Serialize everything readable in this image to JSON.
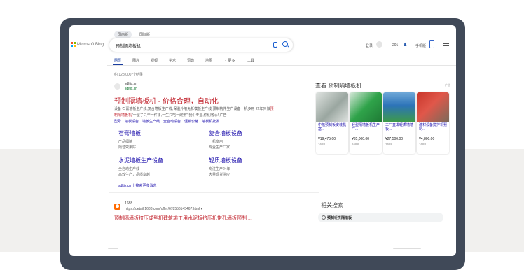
{
  "header": {
    "scopes": [
      {
        "label": "国内版",
        "active": true
      },
      {
        "label": "国际版",
        "active": false
      }
    ],
    "logo_text": "Microsoft Bing",
    "query": "预制隔墙板机",
    "sign_in": "登录",
    "points": "201",
    "mobile": "手机版"
  },
  "tabs": [
    {
      "label": "网页",
      "active": true
    },
    {
      "label": "图片",
      "active": false
    },
    {
      "label": "视频",
      "active": false
    },
    {
      "label": "学术",
      "active": false
    },
    {
      "label": "词典",
      "active": false
    },
    {
      "label": "地图",
      "active": false
    },
    {
      "label": "⋮ 更多",
      "active": false
    },
    {
      "label": "工具",
      "active": false
    }
  ],
  "result_count": "约 128,000 个结果",
  "result1": {
    "site": "sdltjx.cn",
    "url": "sdltjx.cn",
    "title": "预制隔墙板机 - 价格合理，自动化",
    "snippet1_a": "设备 石膏墙板生产线,复合墙板生产线,保温外墙免拆模板生产线,预制构件生产设备一机多用 22年只做",
    "snippet1_b": "预",
    "snippet2_a": "制隔墙板机",
    "snippet2_b": "\"一屋子只干一件事,一生只吃一碗粥\",我们专业,你们省心! 广告",
    "links": [
      "型号",
      "墙板设备",
      "墙板生产线",
      "全自动设备",
      "促销价格",
      "墙板机批发"
    ],
    "sitelinks": [
      {
        "title": "石膏墙板",
        "d1": "产品细腻",
        "d2": "隔音效果好"
      },
      {
        "title": "复合墙板设备",
        "d1": "一机多用",
        "d2": "专业生产厂家"
      },
      {
        "title": "水泥墙板生产设备",
        "d1": "全自动生产线",
        "d2": "高效生产，品质卓越"
      },
      {
        "title": "轻质墙板设备",
        "d1": "专注生产24年",
        "d2": "大量现货供应"
      }
    ],
    "more": "sdltjx.cn 上搜索更多消息"
  },
  "result2": {
    "site": "1688",
    "url": "https://detail.1688.com/offer/678556145467.html ▾",
    "title": "预制隔墙板挤压成型机建筑施工用水泥板挤压机带孔墙板预制 ..."
  },
  "right": {
    "title": "查看 预制隔墙板机",
    "ad": "广告",
    "products": [
      {
        "name": "中拓预制板安装机塞...",
        "price": "¥19,475.00",
        "shop": "1688",
        "color1": "#9aa6a0",
        "color2": "#dfe3e0"
      },
      {
        "name": "轻型隔墙板机生产厂...",
        "price": "¥35,000.00",
        "shop": "1688",
        "color1": "#2fa34a",
        "color2": "#d7e8da"
      },
      {
        "name": "工厂直发轻质墙墙板...",
        "price": "¥27,500.00",
        "shop": "1688",
        "color1": "#2c73b8",
        "color2": "#3d9a4a"
      },
      {
        "name": "建材设备搅拌机预制...",
        "price": "¥4,800.00",
        "shop": "1688",
        "color1": "#c9362b",
        "color2": "#7a6a5a"
      }
    ],
    "related_title": "相关搜索",
    "related_item_a": "预制",
    "related_item_b": "轻质",
    "related_item_c": "隔墙板"
  }
}
